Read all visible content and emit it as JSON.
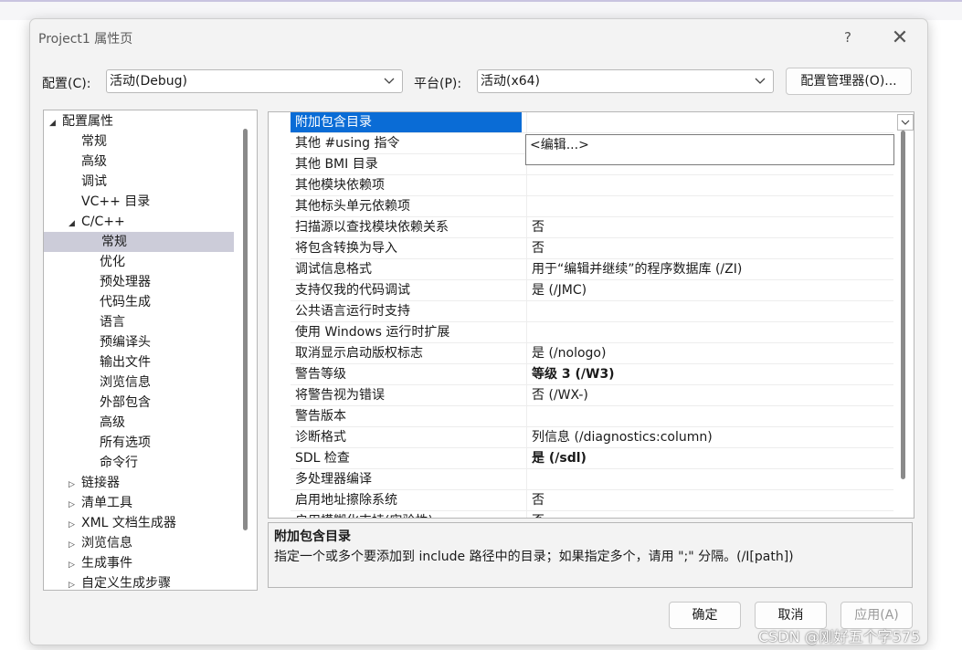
{
  "window": {
    "title": "Project1 属性页",
    "help": "?",
    "close": "✕"
  },
  "config_bar": {
    "config_label": "配置(C):",
    "config_value": "活动(Debug)",
    "platform_label": "平台(P):",
    "platform_value": "活动(x64)",
    "manager_button": "配置管理器(O)..."
  },
  "tree": {
    "items": [
      {
        "label": "配置属性",
        "expander": "◢"
      },
      {
        "label": "常规"
      },
      {
        "label": "高级"
      },
      {
        "label": "调试"
      },
      {
        "label": "VC++ 目录"
      },
      {
        "label": "C/C++",
        "expander": "◢"
      },
      {
        "label": "常规",
        "selected": true
      },
      {
        "label": "优化"
      },
      {
        "label": "预处理器"
      },
      {
        "label": "代码生成"
      },
      {
        "label": "语言"
      },
      {
        "label": "预编译头"
      },
      {
        "label": "输出文件"
      },
      {
        "label": "浏览信息"
      },
      {
        "label": "外部包含"
      },
      {
        "label": "高级"
      },
      {
        "label": "所有选项"
      },
      {
        "label": "命令行"
      },
      {
        "label": "链接器",
        "expander": "▷"
      },
      {
        "label": "清单工具",
        "expander": "▷"
      },
      {
        "label": "XML 文档生成器",
        "expander": "▷"
      },
      {
        "label": "浏览信息",
        "expander": "▷"
      },
      {
        "label": "生成事件",
        "expander": "▷"
      },
      {
        "label": "自定义生成步骤",
        "expander": "▷"
      }
    ]
  },
  "grid": {
    "rows": [
      {
        "name": "附加包含目录",
        "value": "",
        "selected": true
      },
      {
        "name": "其他 #using 指令",
        "value": ""
      },
      {
        "name": "其他 BMI 目录",
        "value": ""
      },
      {
        "name": "其他模块依赖项",
        "value": ""
      },
      {
        "name": "其他标头单元依赖项",
        "value": ""
      },
      {
        "name": "扫描源以查找模块依赖关系",
        "value": "否"
      },
      {
        "name": "将包含转换为导入",
        "value": "否"
      },
      {
        "name": "调试信息格式",
        "value": "用于“编辑并继续”的程序数据库 (/ZI)"
      },
      {
        "name": "支持仅我的代码调试",
        "value": "是 (/JMC)"
      },
      {
        "name": "公共语言运行时支持",
        "value": ""
      },
      {
        "name": "使用 Windows 运行时扩展",
        "value": ""
      },
      {
        "name": "取消显示启动版权标志",
        "value": "是 (/nologo)"
      },
      {
        "name": "警告等级",
        "value": "等级 3 (/W3)",
        "bold": true
      },
      {
        "name": "将警告视为错误",
        "value": "否 (/WX-)"
      },
      {
        "name": "警告版本",
        "value": ""
      },
      {
        "name": "诊断格式",
        "value": "列信息 (/diagnostics:column)"
      },
      {
        "name": "SDL 检查",
        "value": "是 (/sdl)",
        "bold": true
      },
      {
        "name": "多处理器编译",
        "value": ""
      },
      {
        "name": "启用地址擦除系统",
        "value": "否"
      },
      {
        "name": "启用模糊化支持(实验性)",
        "value": "否"
      }
    ],
    "popup_text": "<编辑...>"
  },
  "description": {
    "title": "附加包含目录",
    "text": "指定一个或多个要添加到 include 路径中的目录；如果指定多个，请用 \";\" 分隔。(/I[path])"
  },
  "buttons": {
    "ok": "确定",
    "cancel": "取消",
    "apply": "应用(A)"
  },
  "watermark": "CSDN @刚好五个字575",
  "colors": {
    "selection": "#0a6cd6",
    "tree_selection": "#ccccd9",
    "dialog_bg": "#f3f3f3"
  }
}
